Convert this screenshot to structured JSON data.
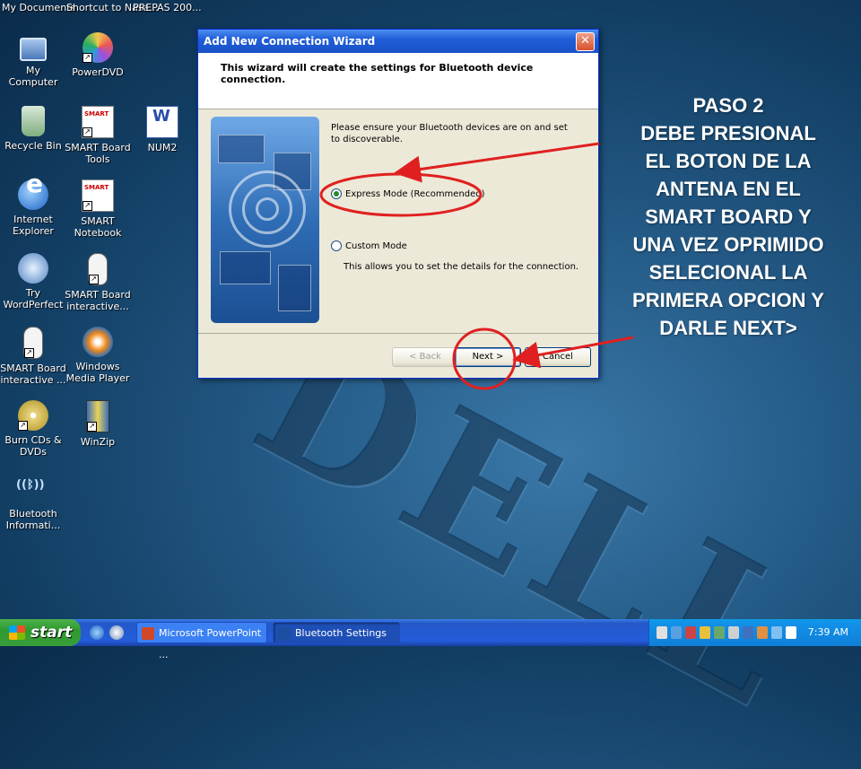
{
  "top_strip": {
    "left": "My Documents",
    "mid": "Shortcut to Nasa...",
    "right": "PREPAS 200..."
  },
  "desktop_icons": [
    {
      "label": "My Computer",
      "icon": "my-computer-icon"
    },
    {
      "label": "PowerDVD",
      "icon": "powerdvd-icon"
    },
    {
      "label": "Recycle Bin",
      "icon": "recycle-bin-icon"
    },
    {
      "label": "SMART Board Tools",
      "icon": "smart-board-icon"
    },
    {
      "label": "NUM2",
      "icon": "word-document-icon"
    },
    {
      "label": "Internet Explorer",
      "icon": "internet-explorer-icon"
    },
    {
      "label": "SMART Notebook",
      "icon": "smart-notebook-icon"
    },
    {
      "label": "Try WordPerfect",
      "icon": "wordperfect-icon"
    },
    {
      "label": "SMART Board interactive...",
      "icon": "mouse-icon"
    },
    {
      "label": "SMART Board interactive ...",
      "icon": "mouse-icon"
    },
    {
      "label": "Windows Media Player",
      "icon": "media-player-icon"
    },
    {
      "label": "Burn CDs & DVDs",
      "icon": "cd-icon"
    },
    {
      "label": "WinZip",
      "icon": "winzip-icon"
    },
    {
      "label": "Bluetooth Informati...",
      "icon": "bluetooth-icon"
    }
  ],
  "dialog": {
    "title": "Add New Connection Wizard",
    "close_glyph": "✕",
    "header": "This wizard will create the settings for Bluetooth device connection.",
    "intro": "Please ensure your Bluetooth devices are on and set to discoverable.",
    "option_express": "Express Mode (Recommended)",
    "option_custom": "Custom Mode",
    "custom_desc": "This allows you to set the details for the connection.",
    "back": "< Back",
    "next": "Next >",
    "cancel": "Cancel",
    "selected_option": "express"
  },
  "annotation": {
    "step": "PASO 2",
    "lines": [
      "DEBE PRESIONAL",
      "EL BOTON DE LA",
      "ANTENA EN EL",
      "SMART BOARD Y",
      "UNA VEZ OPRIMIDO",
      "SELECIONAL LA",
      "PRIMERA OPCION Y",
      "DARLE NEXT>"
    ],
    "color": "#e02020"
  },
  "taskbar": {
    "start": "start",
    "tasks": [
      {
        "label": "Microsoft PowerPoint ...",
        "icon": "powerpoint-icon"
      },
      {
        "label": "Bluetooth Settings",
        "icon": "bluetooth-icon"
      }
    ],
    "clock": "7:39 AM",
    "colors": {
      "taskbar": "#245dda",
      "start": "#3a9d3a",
      "tray": "#0f7fd8"
    }
  }
}
